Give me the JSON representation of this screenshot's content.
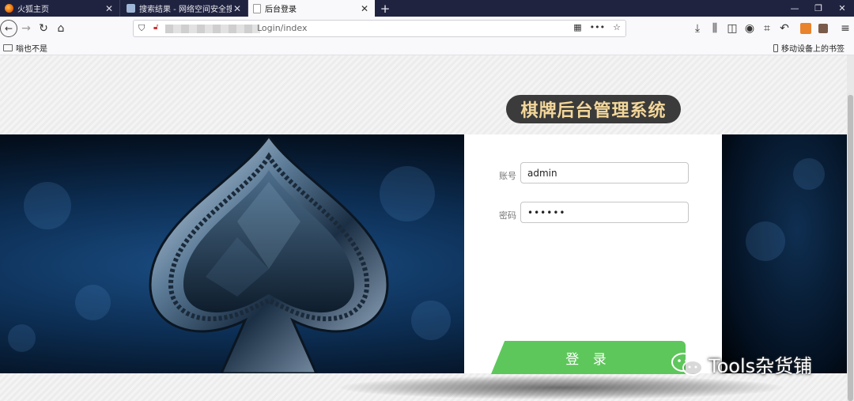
{
  "tabs": [
    {
      "label": "火狐主页",
      "close": "✕",
      "icon": "firefox-icon"
    },
    {
      "label": "搜索结果 - 网络空间安全搜索引",
      "close": "✕",
      "icon": "search-page-icon"
    },
    {
      "label": "后台登录",
      "close": "✕",
      "icon": "page-icon",
      "active": true
    }
  ],
  "new_tab": "+",
  "window_controls": {
    "minimize": "—",
    "restore": "❐",
    "close": "✕"
  },
  "nav": {
    "back": "←",
    "forward": "→",
    "reload": "↻",
    "home": "⌂"
  },
  "url": {
    "visible_path": "Login/index"
  },
  "bookmarks": {
    "left": "嗡也不是",
    "right": "移动设备上的书签"
  },
  "page": {
    "title": "棋牌后台管理系统",
    "account_label": "账号",
    "account_value": "admin",
    "password_label": "密码",
    "password_value": "••••••",
    "login_button": "登 录"
  },
  "watermark": "Tools杂货铺",
  "colors": {
    "login_green": "#5ec75b",
    "title_gold": "#f3d79a",
    "tabbar": "#202340"
  }
}
